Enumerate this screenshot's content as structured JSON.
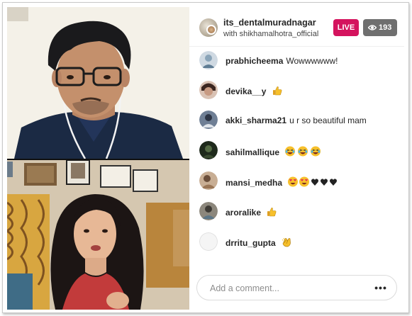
{
  "header": {
    "host_name": "its_dentalmuradnagar",
    "with_text": "with shikhamalhotra_official",
    "live_label": "LIVE",
    "viewer_icon": "eye-icon",
    "viewer_count": "193"
  },
  "video": {
    "top_participant_icon": "man-with-glasses-video",
    "bottom_participant_icon": "woman-speaking-video"
  },
  "comments": [
    {
      "user": "prabhicheema",
      "text": "Wowwwwww!",
      "emoji": "",
      "avatar_color": "#9fb7c9"
    },
    {
      "user": "devika__y",
      "text": "",
      "emoji": "thumbs-up",
      "avatar_color": "#b88f7a"
    },
    {
      "user": "akki_sharma21",
      "text": "u r so beautiful mam",
      "emoji": "",
      "avatar_color": "#4a5a74"
    },
    {
      "user": "sahilmallique",
      "text": "",
      "emoji": "laughing-x3",
      "avatar_color": "#2d3a2a"
    },
    {
      "user": "mansi_medha",
      "text": "",
      "emoji": "heart-eyes-x2-black-hearts-x3",
      "avatar_color": "#b89a7e"
    },
    {
      "user": "aroralike",
      "text": "",
      "emoji": "thumbs-up",
      "avatar_color": "#6d6a63"
    },
    {
      "user": "drritu_gupta",
      "text": "",
      "emoji": "clapping",
      "avatar_color": "#f2f2f2"
    }
  ],
  "comment_box": {
    "placeholder": "Add a comment...",
    "more_label": "•••"
  }
}
